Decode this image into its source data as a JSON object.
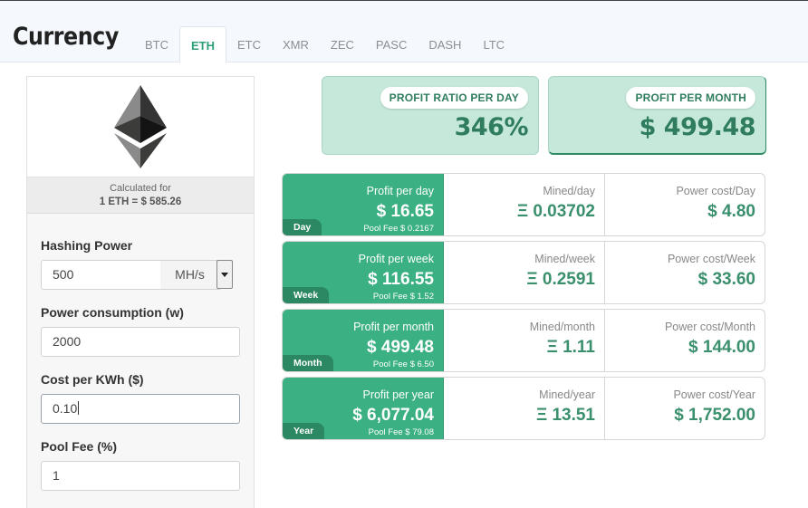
{
  "header": {
    "title": "Currency",
    "tabs": [
      {
        "label": "BTC"
      },
      {
        "label": "ETH"
      },
      {
        "label": "ETC"
      },
      {
        "label": "XMR"
      },
      {
        "label": "ZEC"
      },
      {
        "label": "PASC"
      },
      {
        "label": "DASH"
      },
      {
        "label": "LTC"
      }
    ],
    "active_tab": "ETH"
  },
  "sidebar": {
    "logo_icon": "ethereum-diamond-icon",
    "calculated_for_label": "Calculated for",
    "rate_text": "1 ETH = $ 585.26",
    "fields": {
      "hashing_power": {
        "label": "Hashing Power",
        "value": "500",
        "unit": "MH/s"
      },
      "power_consumption": {
        "label": "Power consumption (w)",
        "value": "2000"
      },
      "cost_per_kwh": {
        "label": "Cost per KWh ($)",
        "value": "0.10"
      },
      "pool_fee": {
        "label": "Pool Fee (%)",
        "value": "1"
      }
    }
  },
  "summary": {
    "profit_ratio": {
      "label": "PROFIT RATIO PER DAY",
      "value": "346%"
    },
    "profit_month": {
      "label": "PROFIT PER MONTH",
      "value": "$ 499.48"
    }
  },
  "rows": [
    {
      "period": "Day",
      "profit_label": "Profit per day",
      "profit": "$ 16.65",
      "pool_fee": "Pool Fee $ 0.2167",
      "mined_label": "Mined/day",
      "mined": "Ξ 0.03702",
      "power_label": "Power cost/Day",
      "power": "$ 4.80"
    },
    {
      "period": "Week",
      "profit_label": "Profit per week",
      "profit": "$ 116.55",
      "pool_fee": "Pool Fee $ 1.52",
      "mined_label": "Mined/week",
      "mined": "Ξ 0.2591",
      "power_label": "Power cost/Week",
      "power": "$ 33.60"
    },
    {
      "period": "Month",
      "profit_label": "Profit per month",
      "profit": "$ 499.48",
      "pool_fee": "Pool Fee $ 6.50",
      "mined_label": "Mined/month",
      "mined": "Ξ 1.11",
      "power_label": "Power cost/Month",
      "power": "$ 144.00"
    },
    {
      "period": "Year",
      "profit_label": "Profit per year",
      "profit": "$ 6,077.04",
      "pool_fee": "Pool Fee $ 79.08",
      "mined_label": "Mined/year",
      "mined": "Ξ 13.51",
      "power_label": "Power cost/Year",
      "power": "$ 1,752.00"
    }
  ],
  "colors": {
    "accent_green": "#3bb083",
    "dark_green": "#2b8862",
    "summary_bg": "#c5e8da",
    "value_green": "#3a8f6c"
  }
}
